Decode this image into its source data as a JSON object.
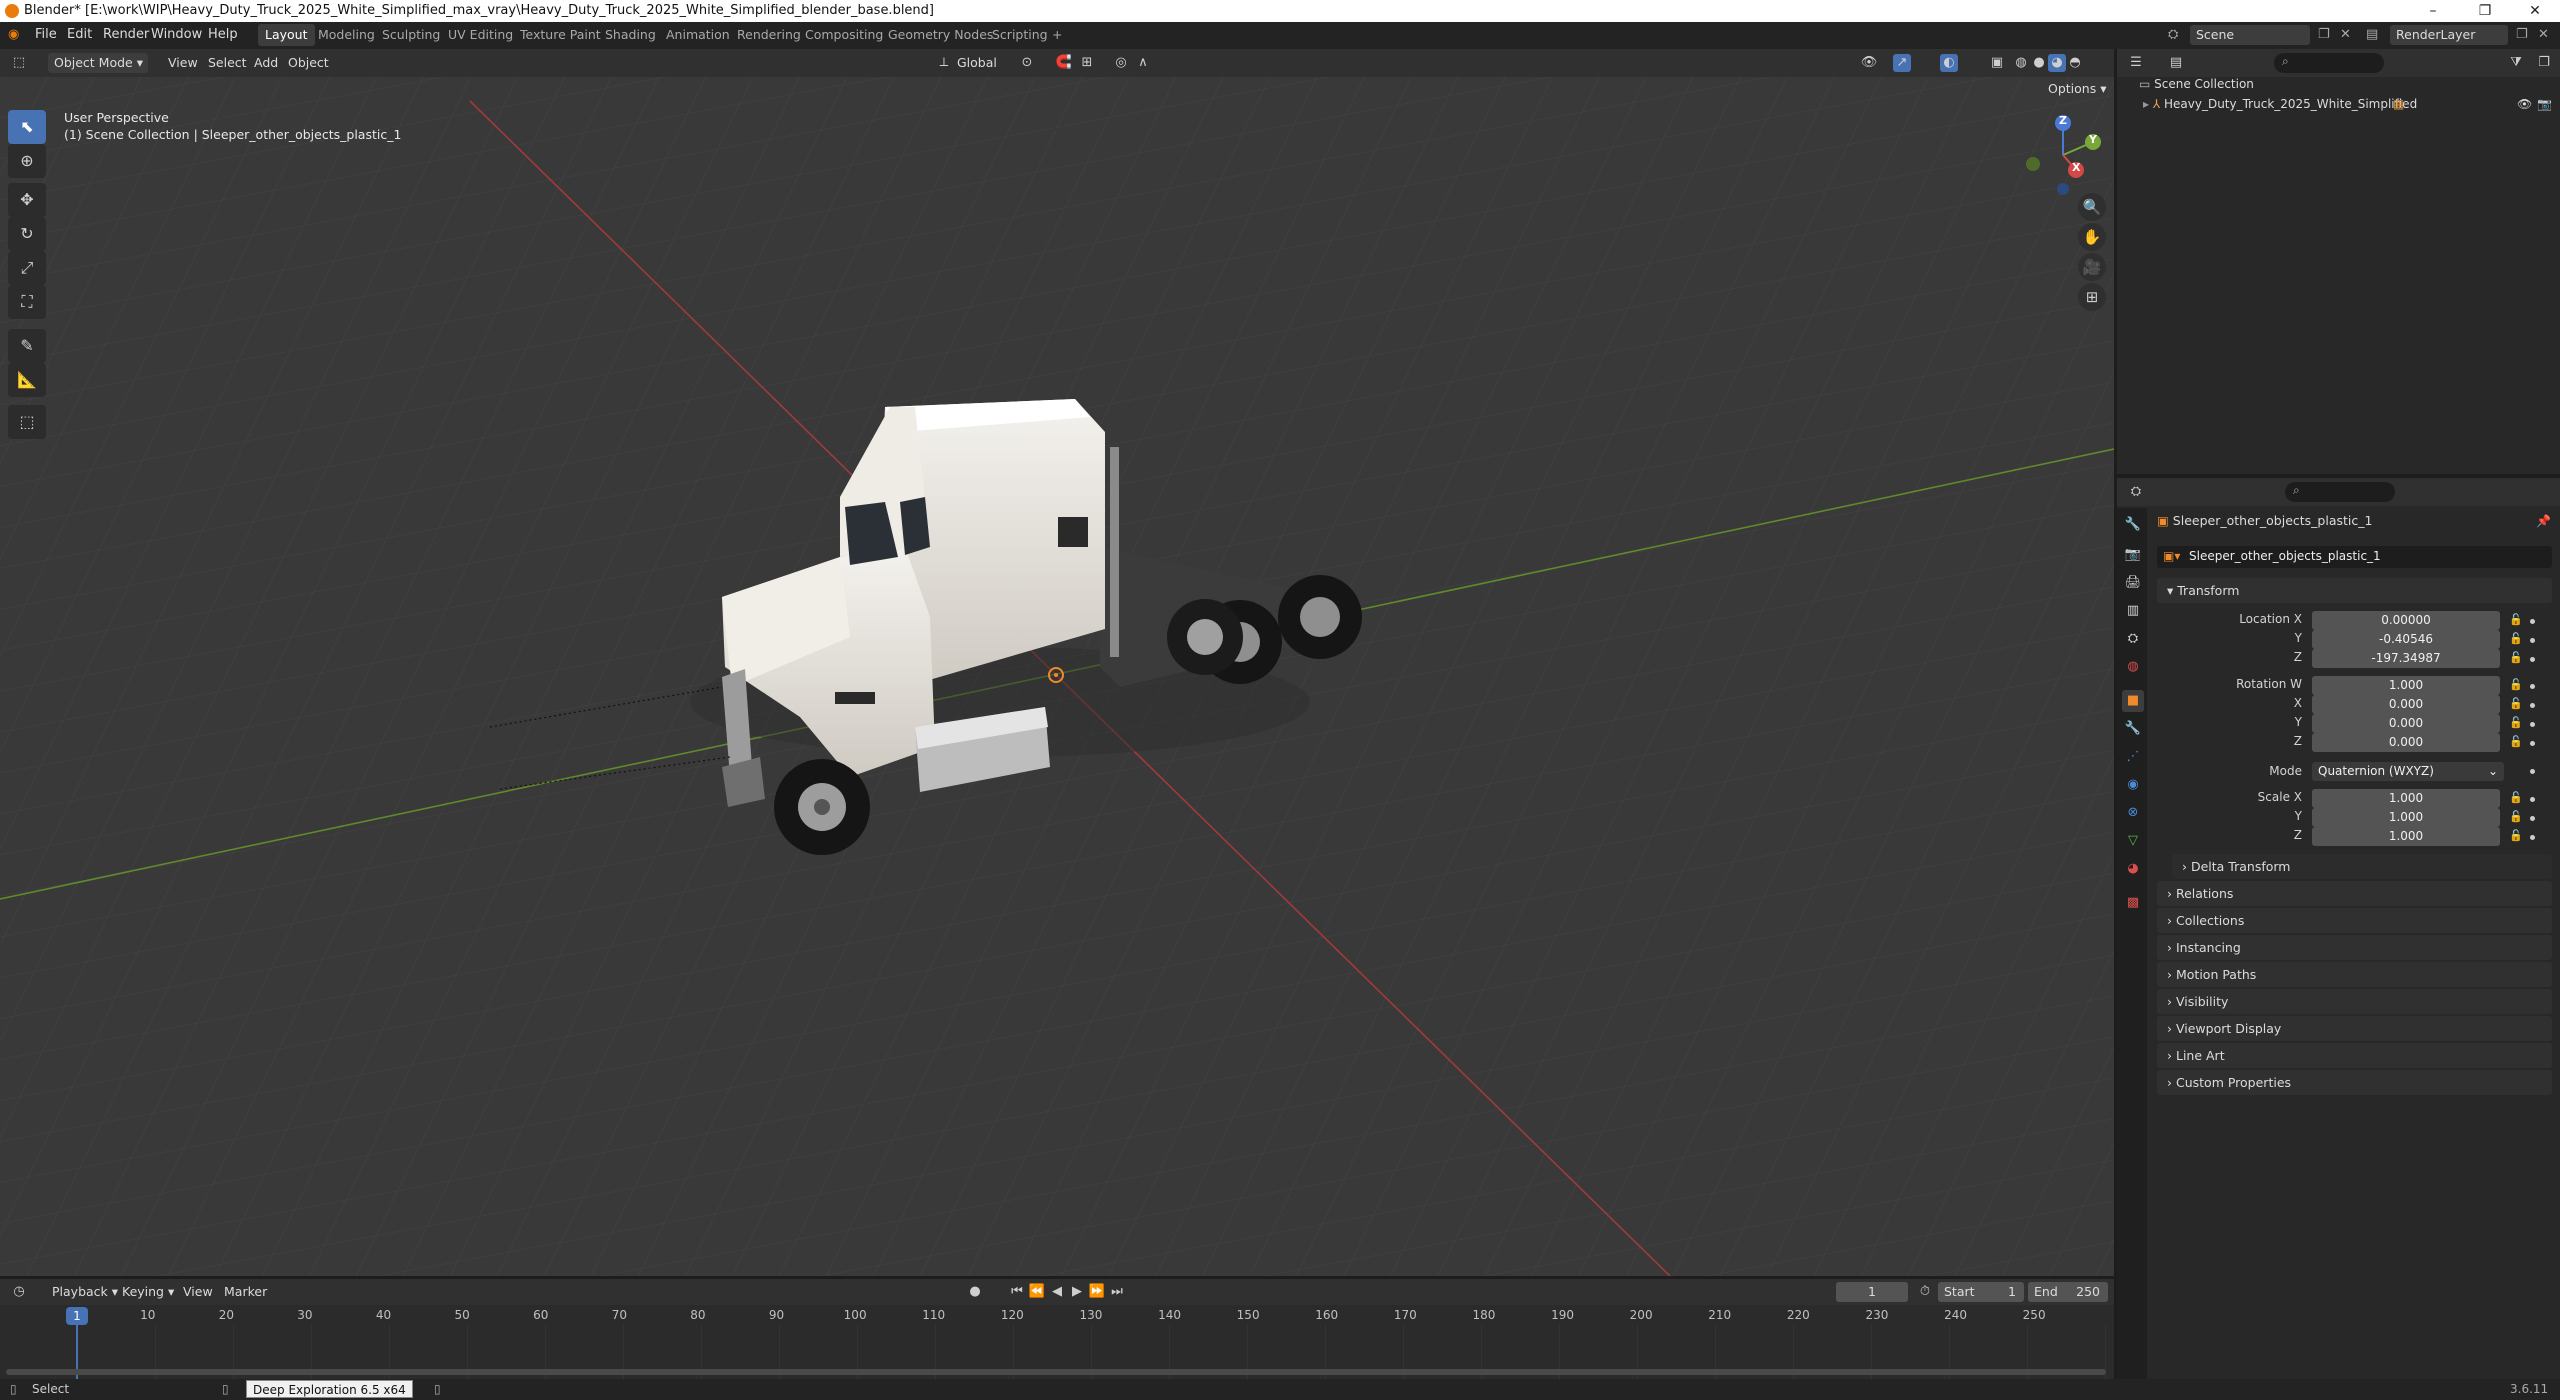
{
  "titlebar": {
    "title": "Blender* [E:\\work\\WIP\\Heavy_Duty_Truck_2025_White_Simplified_max_vray\\Heavy_Duty_Truck_2025_White_Simplified_blender_base.blend]",
    "minimize": "–",
    "maximize": "❐",
    "close": "✕"
  },
  "menu": {
    "items": [
      "File",
      "Edit",
      "Render",
      "Window",
      "Help"
    ],
    "workspaces": [
      "Layout",
      "Modeling",
      "Sculpting",
      "UV Editing",
      "Texture Paint",
      "Shading",
      "Animation",
      "Rendering",
      "Compositing",
      "Geometry Nodes",
      "Scripting"
    ],
    "add_workspace": "+",
    "scene": "Scene",
    "render_layer": "RenderLayer"
  },
  "viewport_header": {
    "mode": "Object Mode",
    "menus": [
      "View",
      "Select",
      "Add",
      "Object"
    ],
    "orientation": "Global",
    "options": "Options"
  },
  "viewport": {
    "perspective": "User Perspective",
    "collection_path": "(1) Scene Collection | Sleeper_other_objects_plastic_1",
    "gizmo_axes": {
      "z": "Z",
      "y": "Y",
      "x": "X"
    },
    "colors": {
      "x_axis": "#b33a3a",
      "y_axis": "#6a9a2f",
      "background": "#393939"
    }
  },
  "outliner": {
    "root": "Scene Collection",
    "items": [
      {
        "label": "Heavy_Duty_Truck_2025_White_Simplified"
      }
    ]
  },
  "properties": {
    "object_name": "Sleeper_other_objects_plastic_1",
    "data_name": "Sleeper_other_objects_plastic_1",
    "transform_title": "Transform",
    "location_label": "Location X",
    "location": {
      "x": "0.00000",
      "y": "-0.40546",
      "z": "-197.34987"
    },
    "rotation_label": "Rotation W",
    "rotation": {
      "w": "1.000",
      "x": "0.000",
      "y": "0.000",
      "z": "0.000"
    },
    "mode_label": "Mode",
    "mode_value": "Quaternion (WXYZ)",
    "scale_label": "Scale X",
    "scale": {
      "x": "1.000",
      "y": "1.000",
      "z": "1.000"
    },
    "axis_labels": {
      "x": "X",
      "y": "Y",
      "z": "Z"
    },
    "delta": "Delta Transform",
    "sections": [
      "Relations",
      "Collections",
      "Instancing",
      "Motion Paths",
      "Visibility",
      "Viewport Display",
      "Line Art",
      "Custom Properties"
    ]
  },
  "timeline": {
    "menus": [
      "Playback",
      "Keying",
      "View",
      "Marker"
    ],
    "current_frame": "1",
    "start_label": "Start",
    "start": "1",
    "end_label": "End",
    "end": "250",
    "ruler": [
      "1",
      "10",
      "20",
      "30",
      "40",
      "50",
      "60",
      "70",
      "80",
      "90",
      "100",
      "110",
      "120",
      "130",
      "140",
      "150",
      "160",
      "170",
      "180",
      "190",
      "200",
      "210",
      "220",
      "230",
      "240",
      "250"
    ]
  },
  "status": {
    "select": "Select",
    "tooltip": "Deep Exploration 6.5 x64",
    "version": "3.6.11"
  }
}
